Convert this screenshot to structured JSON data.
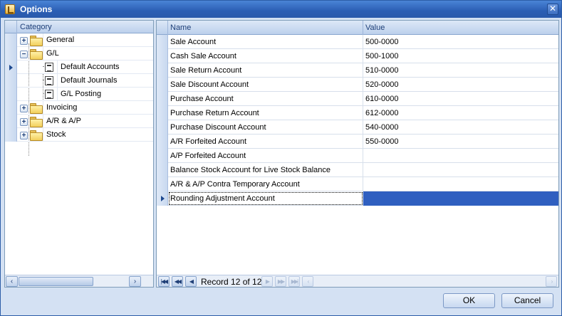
{
  "window": {
    "title": "Options",
    "close_glyph": "✕"
  },
  "category": {
    "header": "Category",
    "items": [
      {
        "label": "General",
        "expander": "+"
      },
      {
        "label": "G/L",
        "expander": "−"
      },
      {
        "label": "Default Accounts"
      },
      {
        "label": "Default Journals"
      },
      {
        "label": "G/L Posting"
      },
      {
        "label": "Invoicing",
        "expander": "+"
      },
      {
        "label": "A/R & A/P",
        "expander": "+"
      },
      {
        "label": "Stock",
        "expander": "+"
      }
    ],
    "scroll_left": "‹",
    "scroll_right": "›"
  },
  "grid": {
    "columns": [
      "Name",
      "Value"
    ],
    "rows": [
      {
        "name": "Sale Account",
        "value": "500-0000"
      },
      {
        "name": "Cash Sale Account",
        "value": "500-1000"
      },
      {
        "name": "Sale Return Account",
        "value": "510-0000"
      },
      {
        "name": "Sale Discount Account",
        "value": "520-0000"
      },
      {
        "name": "Purchase Account",
        "value": "610-0000"
      },
      {
        "name": "Purchase Return Account",
        "value": "612-0000"
      },
      {
        "name": "Purchase Discount Account",
        "value": "540-0000"
      },
      {
        "name": "A/R Forfeited Account",
        "value": "550-0000"
      },
      {
        "name": "A/P Forfeited Account",
        "value": ""
      },
      {
        "name": "Balance Stock Account for Live Stock Balance",
        "value": ""
      },
      {
        "name": "A/R & A/P Contra Temporary Account",
        "value": ""
      },
      {
        "name": "Rounding Adjustment Account",
        "value": ""
      }
    ],
    "navigator": {
      "record_text": "Record 12 of 12",
      "first": "|◀◀",
      "prev_page": "◀◀",
      "prev": "◀",
      "next": "▶",
      "next_page": "▶▶",
      "last": "▶▶|",
      "scroll_left": "‹",
      "scroll_right": "›"
    }
  },
  "buttons": {
    "ok": "OK",
    "cancel": "Cancel"
  },
  "colors": {
    "selection": "#2f5fc0",
    "titlebar": "#2b5eb4",
    "accent": "#1d4990"
  }
}
